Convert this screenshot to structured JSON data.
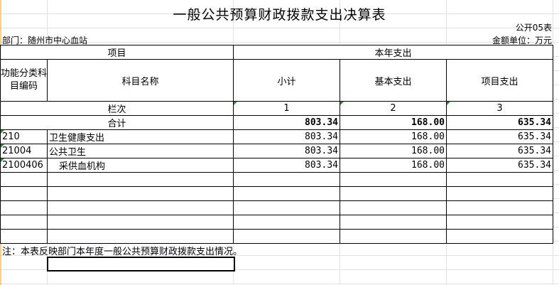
{
  "title": "一般公共预算财政拨款支出决算表",
  "form_no": "公开05表",
  "department": "部门：随州市中心血站",
  "unit": "金额单位：万元",
  "headers": {
    "project": "项目",
    "annual_expense": "本年支出",
    "func_code": "功能分类科目编码",
    "subject_name": "科目名称",
    "subtotal": "小计",
    "basic": "基本支出",
    "project_expense": "项目支出",
    "column_no": "栏次",
    "col1": "1",
    "col2": "2",
    "col3": "3",
    "total_label": "合计"
  },
  "totals": {
    "subtotal": "803.34",
    "basic": "168.00",
    "project": "635.34"
  },
  "rows": [
    {
      "code": "210",
      "name": "卫生健康支出",
      "subtotal": "803.34",
      "basic": "168.00",
      "project": "635.34"
    },
    {
      "code": "21004",
      "name": "公共卫生",
      "subtotal": "803.34",
      "basic": "168.00",
      "project": "635.34"
    },
    {
      "code": "2100406",
      "name": "采供血机构",
      "subtotal": "803.34",
      "basic": "168.00",
      "project": "635.34"
    }
  ],
  "note": "注：本表反映部门本年度一般公共预算财政拨款支出情况。"
}
